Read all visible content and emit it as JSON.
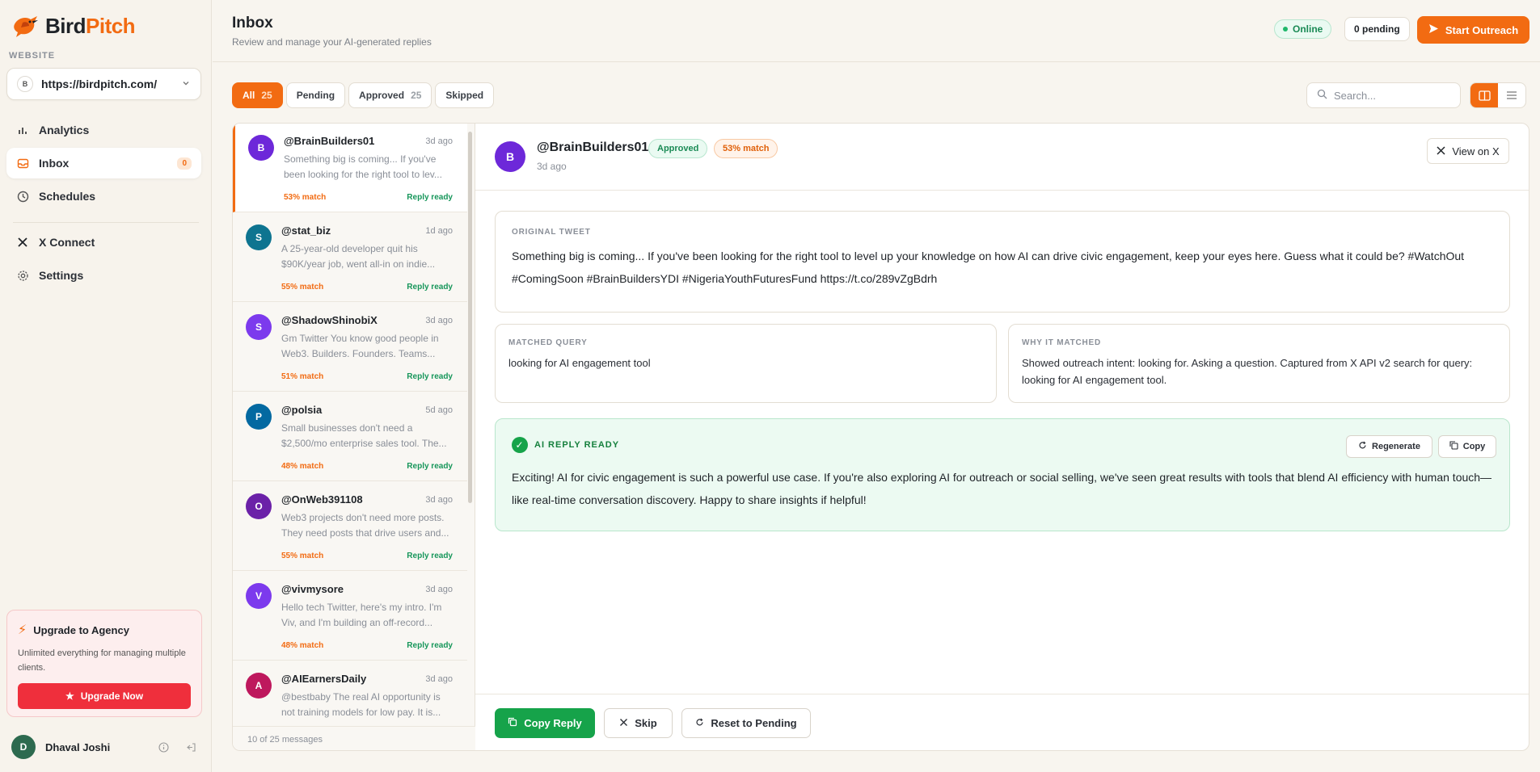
{
  "brand": {
    "name_part1": "Bird",
    "name_part2": "Pitch",
    "accent": "#f26b12"
  },
  "sidebar": {
    "section_label": "WEBSITE",
    "site": {
      "badge": "B",
      "url": "https://birdpitch.com/"
    },
    "items": [
      {
        "label": "Analytics",
        "icon": "bar-chart-icon"
      },
      {
        "label": "Inbox",
        "icon": "inbox-icon",
        "count": "0"
      },
      {
        "label": "Schedules",
        "icon": "clock-icon"
      },
      {
        "label": "X Connect",
        "icon": "x-logo-icon"
      },
      {
        "label": "Settings",
        "icon": "gear-icon"
      }
    ],
    "upgrade": {
      "title": "Upgrade to Agency",
      "desc": "Unlimited everything for managing multiple clients.",
      "button": "Upgrade Now"
    },
    "user": {
      "initial": "D",
      "name": "Dhaval Joshi"
    }
  },
  "header": {
    "title": "Inbox",
    "subtitle": "Review and manage your AI-generated replies",
    "status": "Online",
    "pending": "0 pending",
    "start_button": "Start Outreach"
  },
  "filters": [
    {
      "label": "All",
      "count": "25"
    },
    {
      "label": "Pending",
      "count": ""
    },
    {
      "label": "Approved",
      "count": "25"
    },
    {
      "label": "Skipped",
      "count": ""
    }
  ],
  "search": {
    "placeholder": "Search..."
  },
  "messages": [
    {
      "initial": "B",
      "color": "#6d28d9",
      "handle": "@BrainBuilders01",
      "time": "3d ago",
      "preview": "Something big is coming... If you've been looking for the right tool to lev...",
      "match": "53% match",
      "status": "Reply ready"
    },
    {
      "initial": "S",
      "color": "#0e7490",
      "handle": "@stat_biz",
      "time": "1d ago",
      "preview": "A 25-year-old developer quit his $90K/year job, went all-in on indie...",
      "match": "55% match",
      "status": "Reply ready"
    },
    {
      "initial": "S",
      "color": "#7c3aed",
      "handle": "@ShadowShinobiX",
      "time": "3d ago",
      "preview": "Gm Twitter You know good people in Web3. Builders. Founders. Teams...",
      "match": "51% match",
      "status": "Reply ready"
    },
    {
      "initial": "P",
      "color": "#0369a1",
      "handle": "@polsia",
      "time": "5d ago",
      "preview": "Small businesses don't need a $2,500/mo enterprise sales tool. The...",
      "match": "48% match",
      "status": "Reply ready"
    },
    {
      "initial": "O",
      "color": "#6b21a8",
      "handle": "@OnWeb391108",
      "time": "3d ago",
      "preview": "Web3 projects don't need more posts. They need posts that drive users and...",
      "match": "55% match",
      "status": "Reply ready"
    },
    {
      "initial": "V",
      "color": "#7c3aed",
      "handle": "@vivmysore",
      "time": "3d ago",
      "preview": "Hello tech Twitter, here's my intro. I'm Viv, and I'm building an off-record...",
      "match": "48% match",
      "status": "Reply ready"
    },
    {
      "initial": "A",
      "color": "#be185d",
      "handle": "@AIEarnersDaily",
      "time": "3d ago",
      "preview": "@bestbaby The real AI opportunity is not training models for low pay. It is...",
      "match": "",
      "status": ""
    }
  ],
  "list_footer": "10 of 25 messages",
  "detail": {
    "initial": "B",
    "handle": "@BrainBuilders01",
    "status_badge": "Approved",
    "match_badge": "53% match",
    "time": "3d ago",
    "view_on_x": "View on X",
    "original_label": "ORIGINAL TWEET",
    "original_text": "Something big is coming... If you've been looking for the right tool to level up your knowledge on how AI can drive civic engagement, keep your eyes here. Guess what it could be? #WatchOut #ComingSoon #BrainBuildersYDI #NigeriaYouthFuturesFund https://t.co/289vZgBdrh",
    "matched_label": "MATCHED QUERY",
    "matched_text": "looking for AI engagement tool",
    "why_label": "WHY IT MATCHED",
    "why_text": "Showed outreach intent: looking for. Asking a question. Captured from X API v2 search for query: looking for AI engagement tool.",
    "ai_label": "AI REPLY READY",
    "regenerate": "Regenerate",
    "copy": "Copy",
    "ai_text": "Exciting! AI for civic engagement is such a powerful use case. If you're also exploring AI for outreach or social selling, we've seen great results with tools that blend AI efficiency with human touch—like real-time conversation discovery. Happy to share insights if helpful!",
    "copy_reply": "Copy Reply",
    "skip": "Skip",
    "reset": "Reset to Pending"
  }
}
